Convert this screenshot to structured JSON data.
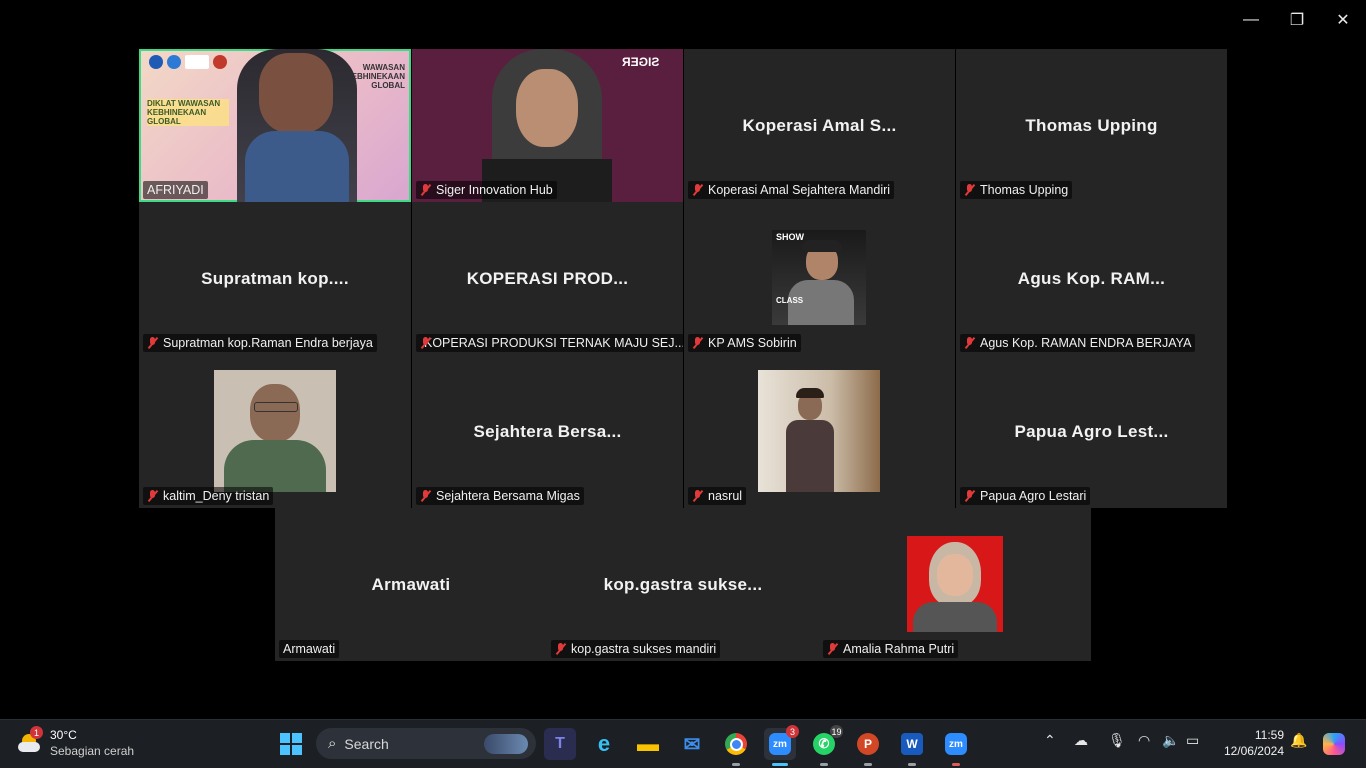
{
  "window": {
    "minimize_icon": "minimize-icon",
    "restore_icon": "restore-icon",
    "close_icon": "close-icon"
  },
  "tiles": {
    "afriyadi": {
      "label": "AFRIYADI",
      "slide_title_top": "WAWASAN KEBHINEKAAN GLOBAL",
      "slide_title": "DIKLAT WAWASAN KEBHINEKAAN GLOBAL"
    },
    "siger": {
      "label": "Siger Innovation Hub",
      "brand": "SIGER"
    },
    "koperasi_amal": {
      "big": "Koperasi Amal S...",
      "label": "Koperasi Amal Sejahtera Mandiri"
    },
    "thomas": {
      "big": "Thomas Upping",
      "label": "Thomas Upping"
    },
    "supratman": {
      "big": "Supratman kop....",
      "label": "Supratman kop.Raman Endra berjaya"
    },
    "koperasi_prod": {
      "big": "KOPERASI PROD...",
      "label": "KOPERASI PRODUKSI TERNAK MAJU SEJ..."
    },
    "kp_ams": {
      "label": "KP AMS Sobirin",
      "avatar_text_top": "SHOW",
      "avatar_text_bottom": "CLASS"
    },
    "agus": {
      "big": "Agus Kop. RAM...",
      "label": "Agus Kop. RAMAN ENDRA BERJAYA"
    },
    "kaltim": {
      "label": "kaltim_Deny tristan"
    },
    "sejahtera": {
      "big": "Sejahtera Bersa...",
      "label": "Sejahtera Bersama Migas"
    },
    "nasrul": {
      "label": "nasrul"
    },
    "papua": {
      "big": "Papua Agro Lest...",
      "label": "Papua Agro Lestari"
    },
    "armawati": {
      "big": "Armawati",
      "label": "Armawati"
    },
    "gastra": {
      "big": "kop.gastra sukse...",
      "label": "kop.gastra sukses mandiri"
    },
    "amalia": {
      "label": "Amalia Rahma Putri"
    }
  },
  "taskbar": {
    "weather": {
      "temp": "30°C",
      "desc": "Sebagian cerah",
      "badge": "1"
    },
    "search_label": "Search",
    "apps": [
      {
        "name": "start",
        "icon": "windows-icon"
      },
      {
        "name": "teams",
        "icon": "teams-icon",
        "glyph": "T"
      },
      {
        "name": "edge",
        "icon": "edge-icon",
        "glyph": "e"
      },
      {
        "name": "explorer",
        "icon": "folder-icon",
        "glyph": "▬"
      },
      {
        "name": "mail",
        "icon": "mail-icon",
        "glyph": "✉"
      },
      {
        "name": "chrome",
        "icon": "chrome-icon",
        "glyph": "●"
      },
      {
        "name": "zoom-meeting",
        "icon": "zoom-icon",
        "glyph": "zm",
        "badge": "3"
      },
      {
        "name": "whatsapp",
        "icon": "whatsapp-icon",
        "glyph": "✆",
        "badge": "19"
      },
      {
        "name": "powerpoint",
        "icon": "powerpoint-icon",
        "glyph": "P"
      },
      {
        "name": "word",
        "icon": "word-icon",
        "glyph": "W"
      },
      {
        "name": "zoom",
        "icon": "zoom-icon",
        "glyph": "zm"
      }
    ],
    "clock": {
      "time": "11:59",
      "date": "12/06/2024"
    }
  }
}
